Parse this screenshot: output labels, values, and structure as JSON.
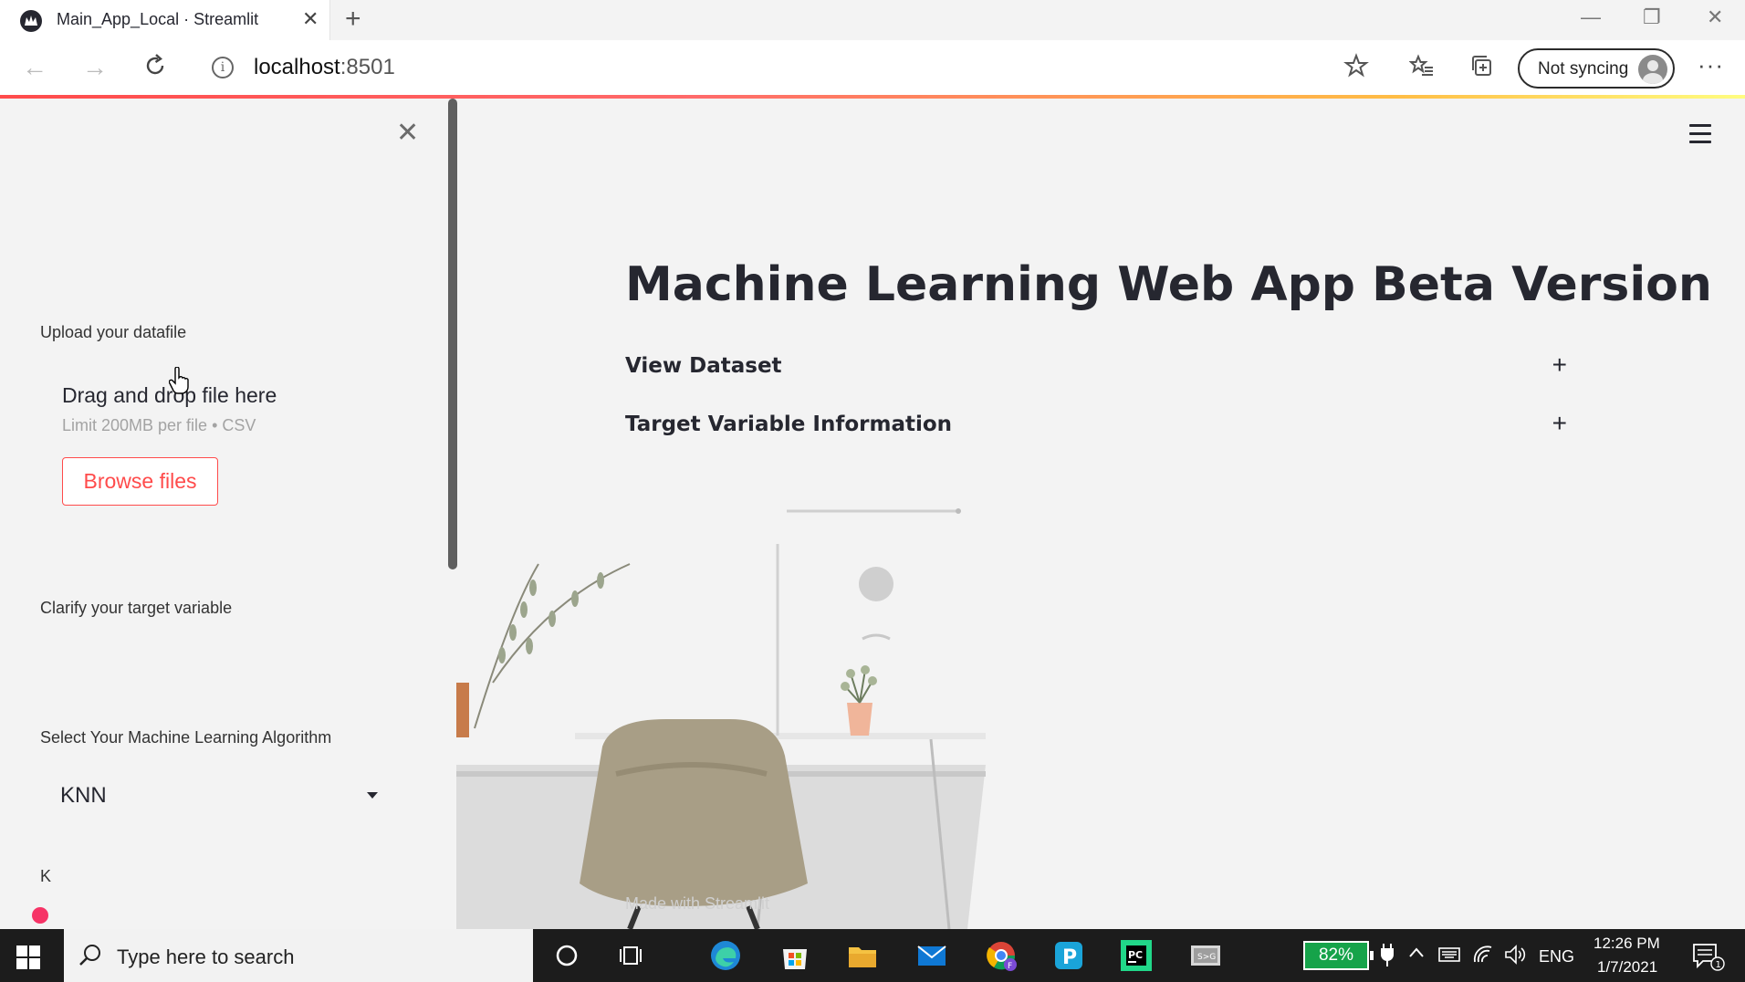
{
  "browser": {
    "tab_title": "Main_App_Local · Streamlit",
    "tab_close": "✕",
    "new_tab": "+",
    "url_host": "localhost",
    "url_port": ":8501",
    "sync_label": "Not syncing",
    "more": "···",
    "window_controls": [
      "—",
      "❐",
      "✕"
    ]
  },
  "sidebar": {
    "close_symbol": "✕",
    "upload_label": "Upload your datafile",
    "drop_title": "Drag and drop file here",
    "drop_limit": "Limit 200MB per file • CSV",
    "browse_label": "Browse files",
    "target_label": "Clarify your target variable",
    "algo_label": "Select Your Machine Learning Algorithm",
    "algo_value": "KNN",
    "k_label": "K",
    "slider_value": 0
  },
  "main": {
    "title": "Machine Learning Web App Beta Version",
    "expanders": [
      {
        "label": "View Dataset",
        "symbol": "+"
      },
      {
        "label": "Target Variable Information",
        "symbol": "+"
      }
    ],
    "footer": "Made with Streamlit"
  },
  "taskbar": {
    "search_placeholder": "Type here to search",
    "battery": "82%",
    "language": "ENG",
    "time": "12:26 PM",
    "date": "1/7/2021",
    "notification_count": "1"
  },
  "colors": {
    "accent": "#ff4b4b",
    "slider": "#f63366",
    "text": "#262730",
    "background": "#f3f3f3"
  }
}
